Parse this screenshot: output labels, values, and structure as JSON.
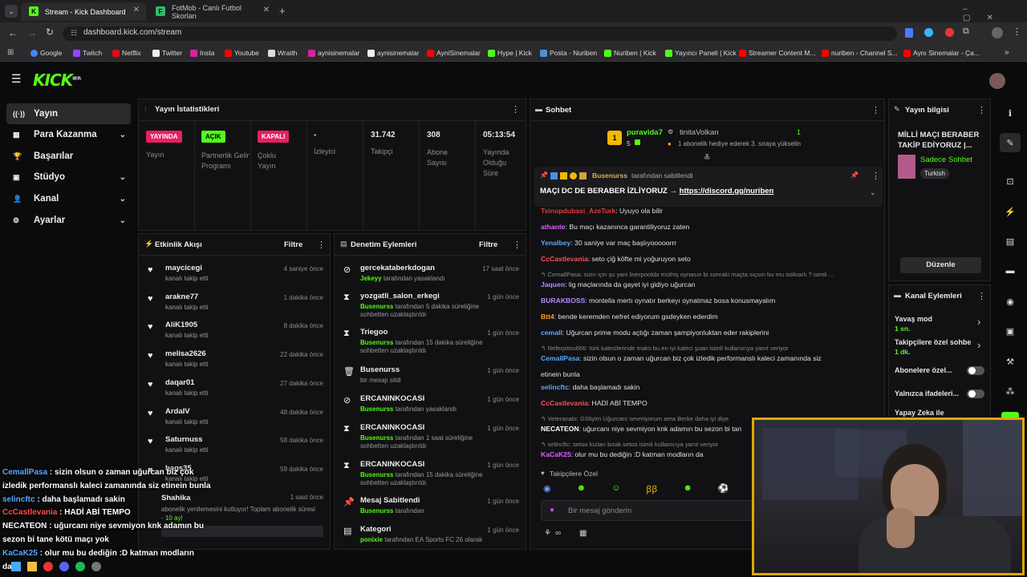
{
  "browser": {
    "tabs": [
      {
        "label": "Stream - Kick Dashboard",
        "close": "✕"
      },
      {
        "label": "FotMob - Canlı Futbol Skorları",
        "close": "✕"
      }
    ],
    "new_tab": "+",
    "url": "dashboard.kick.com/stream",
    "bookmarks": [
      "Google",
      "Twitch",
      "Netflix",
      "Twitter",
      "Insta",
      "Youtube",
      "Wraith",
      "aynisinemalar",
      "aynisinemalar",
      "AyniSinemalar",
      "Hype | Kick",
      "Posta - Nuriben",
      "Nuriben | Kick",
      "Yayıncı Paneli | Kick",
      "Streamer Content M...",
      "nuriben - Channel S...",
      "Aynı Sinemalar - Ça..."
    ],
    "bm_more": "»"
  },
  "header": {
    "logo": "KICK",
    "logo_beta": "BETA"
  },
  "sidebar": {
    "items": [
      {
        "label": "Yayın",
        "icon": "broadcast-icon",
        "glyph": "((·))",
        "chev": ""
      },
      {
        "label": "Para Kazanma",
        "icon": "money-icon",
        "glyph": "▦",
        "chev": "⌄"
      },
      {
        "label": "Başarılar",
        "icon": "trophy-icon",
        "glyph": "🏆",
        "chev": ""
      },
      {
        "label": "Stüdyo",
        "icon": "studio-icon",
        "glyph": "▣",
        "chev": "⌄"
      },
      {
        "label": "Kanal",
        "icon": "user-icon",
        "glyph": "👤",
        "chev": "⌄"
      },
      {
        "label": "Ayarlar",
        "icon": "gear-icon",
        "glyph": "⚙",
        "chev": "⌄"
      }
    ]
  },
  "stats": {
    "title": "Yayın İstatistikleri",
    "items": [
      {
        "badge": "YAYINDA",
        "label": "Yayın",
        "color": "#e91e63"
      },
      {
        "badge": "AÇIK",
        "label": "Partnerlik Gelir Programı",
        "color": "#53fc18"
      },
      {
        "badge": "KAPALI",
        "label": "Çoklu Yayın",
        "color": "#e91e63"
      },
      {
        "value": "-",
        "label": "İzleyici"
      },
      {
        "value": "31.742",
        "label": "Takipçi"
      },
      {
        "value": "308",
        "label": "Abone Sayısı"
      },
      {
        "value": "05:13:54",
        "label": "Yayında Olduğu Süre"
      }
    ]
  },
  "activity": {
    "title": "Etkinlik Akışı",
    "filter": "Filtre",
    "items": [
      {
        "name": "maycicegi",
        "sub": "kanalı takip etti",
        "time": "4 saniye önce"
      },
      {
        "name": "arakne77",
        "sub": "kanalı takip etti",
        "time": "1 dakika önce"
      },
      {
        "name": "AliK1905",
        "sub": "kanalı takip etti",
        "time": "8 dakika önce"
      },
      {
        "name": "melisa2626",
        "sub": "kanalı takip etti",
        "time": "22 dakika önce"
      },
      {
        "name": "daqar01",
        "sub": "kanalı takip etti",
        "time": "27 dakika önce"
      },
      {
        "name": "ArdaIV",
        "sub": "kanalı takip etti",
        "time": "48 dakika önce"
      },
      {
        "name": "Saturnuss",
        "sub": "kanalı takip etti",
        "time": "58 dakika önce"
      },
      {
        "name": "bags35",
        "sub": "kanalı takip etti",
        "time": "59 dakika önce"
      }
    ],
    "sub_item": {
      "name": "Shahika",
      "time": "1 saat önce",
      "text": "abonelik yenilemesini kutluyor! Toplam abonelik süresi - ",
      "months": "10 ay!"
    }
  },
  "moderation": {
    "title": "Denetim Eylemleri",
    "filter": "Filtre",
    "items": [
      {
        "icon": "ban-icon",
        "glyph": "⊘",
        "name": "gercekataberkdogan",
        "actor": "Jekeyy",
        "rest": " tarafından yasaklandı",
        "time": "17 saat önce"
      },
      {
        "icon": "hourglass-icon",
        "glyph": "⧗",
        "name": "yozgatli_salon_erkegi",
        "actor": "Busenurss",
        "rest": " tarafından 5 dakika süreliğine sohbetten uzaklaştırıldı",
        "time": "1 gün önce"
      },
      {
        "icon": "hourglass-icon",
        "glyph": "⧗",
        "name": "Triegoo",
        "actor": "Busenurss",
        "rest": " tarafından 15 dakika süreliğine sohbetten uzaklaştırıldı",
        "time": "1 gün önce"
      },
      {
        "icon": "trash-icon",
        "glyph": "🗑",
        "name": "Busenurss",
        "actor": "",
        "rest": "bir mesajı sildi",
        "time": "1 gün önce"
      },
      {
        "icon": "ban-icon",
        "glyph": "⊘",
        "name": "ERCANINKOCASI",
        "actor": "Busenurss",
        "rest": " tarafından yasaklandı",
        "time": "1 gün önce"
      },
      {
        "icon": "hourglass-icon",
        "glyph": "⧗",
        "name": "ERCANINKOCASI",
        "actor": "Busenurss",
        "rest": " tarafından 1 saat süreliğine sohbetten uzaklaştırıldı",
        "time": "1 gün önce"
      },
      {
        "icon": "hourglass-icon",
        "glyph": "⧗",
        "name": "ERCANINKOCASI",
        "actor": "Busenurss",
        "rest": " tarafından 15 dakika süreliğine sohbetten uzaklaştırıldı",
        "time": "1 gün önce"
      },
      {
        "icon": "pin-icon",
        "glyph": "📌",
        "name": "Mesaj Sabitlendi",
        "actor": "Busenurss",
        "rest": " tarafından",
        "time": "1 gün önce"
      },
      {
        "icon": "category-icon",
        "glyph": "▤",
        "name": "Kategori",
        "actor": "ponixie",
        "rest": " tarafından EA Sports FC 26 olarak",
        "time": "1 gün önce"
      }
    ]
  },
  "chat": {
    "title": "Sohbet",
    "gift": {
      "user": "puravida7",
      "count": "5",
      "target": "tinitaVolkan",
      "target_count": "1",
      "text": "1 abonelik hediye ederek 3. sıraya yükselin",
      "rank": "1"
    },
    "pinned": {
      "by": "Busenurss",
      "by_suffix": " tarafından sabitlendi",
      "text": "MAÇI DC DE BERABER İZLİYORUZ → ",
      "link": "https://discord.gg/nuriben"
    },
    "messages": [
      {
        "user": "Tsinopdubasi_AzeTurk",
        "color": "#e53935",
        "text": ": Uyuyo ola bilir"
      },
      {
        "user": "athante",
        "color": "#e05cff",
        "text": ": Bu maçı kazanınca garantiliyoruz zaten"
      },
      {
        "user": "Yenalbey",
        "color": "#5aa9ff",
        "text": ": 30 saniye var maç başlıyooooorrr"
      },
      {
        "user": "CcCastlevania",
        "color": "#ff4d4d",
        "text": ": seto çiğ köfte mi yoğuruyon seto"
      },
      {
        "reply": "CemallPasa: sizin için şu yani liverpoolda müthiş oynasın bi sonraki maçta sıçsın bu mu istikrarlı ? isimli ..."
      },
      {
        "user": "Jaquen",
        "color": "#b48cff",
        "text": ": lig maçlarında da gayet iyi gidiyo uğurcan"
      },
      {
        "user": "BURAKBOSS",
        "color": "#b48cff",
        "text": ": montella mertı oynatır berkeyı oynatmaz bosa konusmayalım"
      },
      {
        "user": "Btt4",
        "color": "#ff9f1c",
        "text": ": bende keremden nefret ediyorum gsdeyken ederdim"
      },
      {
        "user": "cemall",
        "color": "#5aa9ff",
        "text": ": Uğurcan prime modu açtığı zaman şampiyonluktan eder rakiplerini"
      },
      {
        "reply": "Neferpitou666: türk kalecilerinde maks bu en iyi kaleci şuan isimli kullanıcıya yanıt veriyor"
      },
      {
        "user": "CemallPasa",
        "color": "#5aa9ff",
        "text": ": sizin olsun o zaman uğurcan biz çok izledik performanslı kaleci zamanında siz"
      },
      {
        "cont": "etinein bunla"
      },
      {
        "user": "selincftc",
        "color": "#5aa9ff",
        "text": ": daha başlamadı sakin"
      },
      {
        "user": "CcCastlevania",
        "color": "#ff4d4d",
        "text": ": HADİ ABİ TEMPO"
      },
      {
        "reply": "Veteranabi: GSliyim Uğurcanı sevmiyorum ama Berke daha iyi diye"
      },
      {
        "user": "NECATEON",
        "color": "#ffffff",
        "text": ": uğurcanı niye sevmiyon knk adamın bu sezon bi tan"
      },
      {
        "reply": "selincftc: setoo kızları bırak setoo isimli kullanıcıya yanıt veriyor"
      },
      {
        "user": "KaCaK25",
        "color": "#e05cff",
        "text": ": olur mu bu dediğin :D katman modların da"
      }
    ],
    "followers_only": "Takipçilere Özel",
    "placeholder": "Bir mesaj gönderin",
    "emotes": [
      "◉",
      "☻",
      "☺",
      "ꞵꞵ",
      "☻",
      "⚽"
    ]
  },
  "stream_info": {
    "title": "Yayın bilgisi",
    "stream_title": "MİLLİ MAÇI BERABER TAKİP EDİYORUZ |...",
    "category": "Sadece Sohbet",
    "language": "Turkish",
    "edit": "Düzenle"
  },
  "channel_actions": {
    "title": "Kanal Eylemleri",
    "items": [
      {
        "label": "Yavaş mod",
        "value": "1 sn.",
        "control": "›"
      },
      {
        "label": "Takipçilere özel sohbe",
        "value": "1 dk.",
        "control": "›"
      },
      {
        "label": "Abonelere özel...",
        "value": "",
        "control": "toggle"
      },
      {
        "label": "Yalnızca ifadeleri...",
        "value": "",
        "control": "toggle"
      },
      {
        "label": "Yapay Zeka ile",
        "value": "",
        "control": ""
      }
    ]
  },
  "overlay_chat": [
    {
      "user": "CemallPasa",
      "color": "#5aa9ff",
      "text": " : sizin olsun o zaman uğurcan biz çok"
    },
    {
      "cont": "izledik performanslı kaleci zamanında siz etinein bunla"
    },
    {
      "user": "selincftc",
      "color": "#5aa9ff",
      "text": " : daha başlamadı sakin"
    },
    {
      "user": "CcCastlevania",
      "color": "#ff4d4d",
      "text": " : HADİ ABİ TEMPO"
    },
    {
      "user": "NECATEON",
      "color": "#ffffff",
      "text": " : uğurcanı niye sevmiyon knk adamın bu"
    },
    {
      "cont": "sezon bi tane kötü maçı yok"
    },
    {
      "user": "KaCaK25",
      "color": "#5aa9ff",
      "text": " : olur mu bu dediğin :D katman modların"
    },
    {
      "cont": "da"
    }
  ],
  "colors": {
    "accent": "#53fc18",
    "live": "#e91e63",
    "webcam_border": "#e0a800"
  }
}
